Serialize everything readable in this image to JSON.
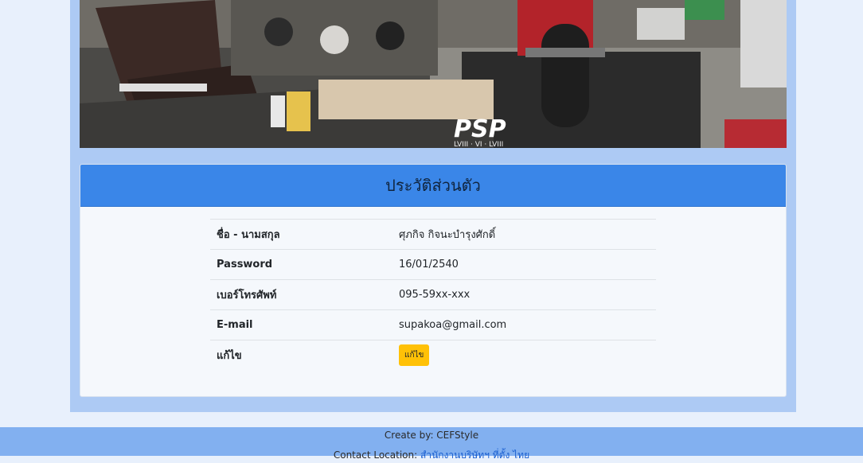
{
  "banner": {
    "logo_text": "PSP",
    "logo_sub": "LVIII · VI · LVIII"
  },
  "profile": {
    "title": "ประวัติส่วนตัว",
    "rows": [
      {
        "label": "ชื่อ - นามสกุล",
        "value": "ศุภกิจ กิจนะบำรุงศักดิ์"
      },
      {
        "label": "Password",
        "value": "16/01/2540"
      },
      {
        "label": "เบอร์โทรศัพท์",
        "value": "095-59xx-xxx"
      },
      {
        "label": "E-mail",
        "value": "supakoa@gmail.com"
      }
    ],
    "edit_label": "แก้ไข",
    "edit_button": "แก้ไข"
  },
  "footer": {
    "created_by": "Create by: CEFStyle",
    "contact_label": "Contact Location:",
    "contact_link": "สำนักงานบริษัทฯ ที่ตั้ง ไทย"
  },
  "colors": {
    "header": "#3a86e8",
    "edit_button": "#ffc107",
    "footer": "#82b0f0"
  }
}
